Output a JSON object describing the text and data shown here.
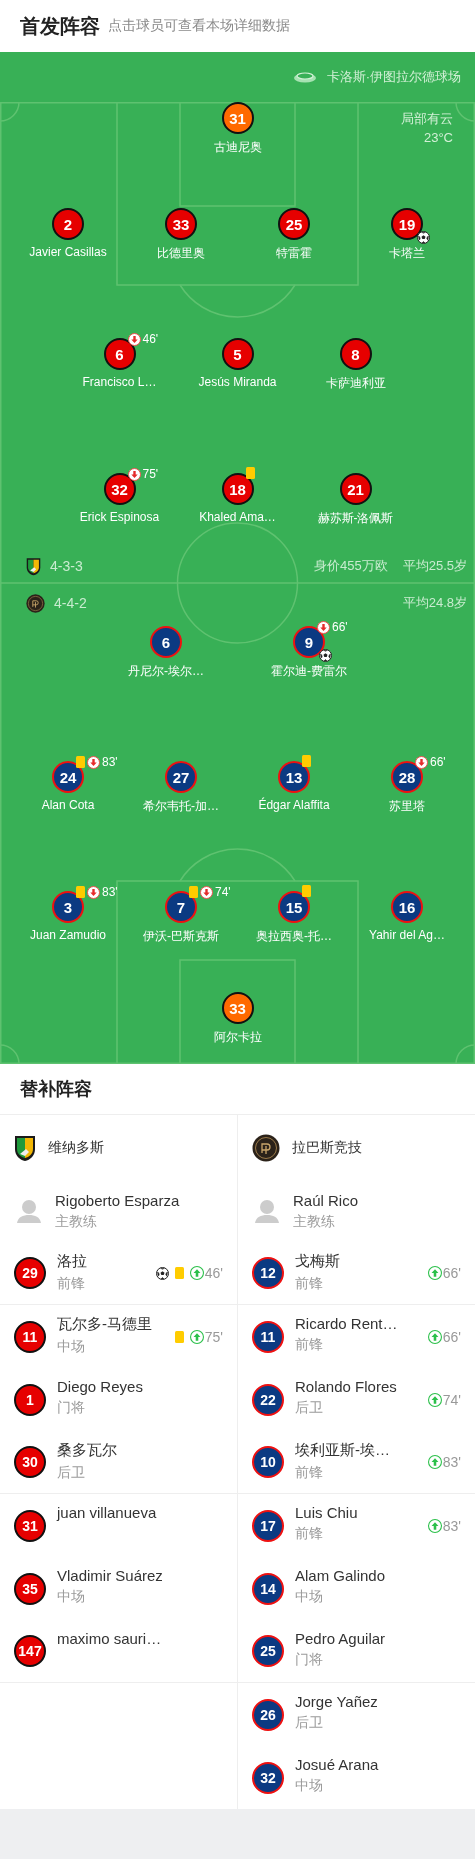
{
  "header": {
    "title": "首发阵容",
    "subtitle": "点击球员可查看本场详细数据"
  },
  "pitch": {
    "stadium": "卡洛斯·伊图拉尔德球场",
    "weather": {
      "condition": "局部有云",
      "temperature": "23°C"
    },
    "teams": [
      {
        "kind": "home",
        "formation": "4-3-3",
        "market_value": "身价455万欧",
        "average_age": "平均25.5岁",
        "lines": [
          [
            {
              "number": "31",
              "name": "古迪尼奥",
              "kind": "goalkeeper"
            }
          ],
          [
            {
              "number": "2",
              "name": "Javier Casillas",
              "kind": "outfield"
            },
            {
              "number": "33",
              "name": "比德里奥",
              "kind": "outfield"
            },
            {
              "number": "25",
              "name": "特雷霍",
              "kind": "outfield"
            },
            {
              "number": "19",
              "name": "卡塔兰",
              "kind": "outfield",
              "events": [
                {
                  "kind": "goal"
                }
              ]
            }
          ],
          [
            {
              "number": "6",
              "name": "Francisco L…",
              "kind": "outfield",
              "events": [
                {
                  "kind": "sub_out",
                  "minute": "46'"
                }
              ]
            },
            {
              "number": "5",
              "name": "Jesús Miranda",
              "kind": "outfield"
            },
            {
              "number": "8",
              "name": "卡萨迪利亚",
              "kind": "outfield"
            }
          ],
          [
            {
              "number": "32",
              "name": "Erick Espinosa",
              "kind": "outfield",
              "events": [
                {
                  "kind": "sub_out",
                  "minute": "75'"
                }
              ]
            },
            {
              "number": "18",
              "name": "Khaled Ama…",
              "kind": "outfield",
              "events": [
                {
                  "kind": "yellow_card"
                }
              ]
            },
            {
              "number": "21",
              "name": "赫苏斯-洛佩斯",
              "kind": "outfield"
            }
          ]
        ]
      },
      {
        "kind": "away",
        "formation": "4-4-2",
        "average_age": "平均24.8岁",
        "lines": [
          [
            {
              "number": "6",
              "name": "丹尼尔-埃尔…",
              "kind": "outfield"
            },
            {
              "number": "9",
              "name": "霍尔迪-费雷尔",
              "kind": "outfield",
              "events": [
                {
                  "kind": "sub_out",
                  "minute": "66'"
                },
                {
                  "kind": "goal"
                }
              ]
            }
          ],
          [
            {
              "number": "24",
              "name": "Alan Cota",
              "kind": "outfield",
              "events": [
                {
                  "kind": "yellow_card"
                },
                {
                  "kind": "sub_out",
                  "minute": "83'"
                }
              ]
            },
            {
              "number": "27",
              "name": "希尔韦托-加…",
              "kind": "outfield"
            },
            {
              "number": "13",
              "name": "Édgar Alaffita",
              "kind": "outfield",
              "events": [
                {
                  "kind": "yellow_card"
                }
              ]
            },
            {
              "number": "28",
              "name": "苏里塔",
              "kind": "outfield",
              "events": [
                {
                  "kind": "sub_out",
                  "minute": "66'"
                }
              ]
            }
          ],
          [
            {
              "number": "3",
              "name": "Juan Zamudio",
              "kind": "outfield",
              "events": [
                {
                  "kind": "yellow_card"
                },
                {
                  "kind": "sub_out",
                  "minute": "83'"
                }
              ]
            },
            {
              "number": "7",
              "name": "伊沃-巴斯克斯",
              "kind": "outfield",
              "events": [
                {
                  "kind": "yellow_card"
                },
                {
                  "kind": "sub_out",
                  "minute": "74'"
                }
              ]
            },
            {
              "number": "15",
              "name": "奥拉西奥-托…",
              "kind": "outfield",
              "events": [
                {
                  "kind": "yellow_card"
                }
              ]
            },
            {
              "number": "16",
              "name": "Yahir del Ag…",
              "kind": "outfield"
            }
          ],
          [
            {
              "number": "33",
              "name": "阿尔卡拉",
              "kind": "goalkeeper"
            }
          ]
        ]
      }
    ]
  },
  "substitutes": {
    "title": "替补阵容",
    "teams": [
      {
        "kind": "home",
        "name": "维纳多斯",
        "coach": {
          "name": "Rigoberto Esparza",
          "role": "主教练"
        },
        "players": [
          {
            "number": "29",
            "name": "洛拉",
            "position": "前锋",
            "events": [
              {
                "kind": "goal"
              },
              {
                "kind": "yellow_card"
              },
              {
                "kind": "sub_in",
                "minute": "46'"
              }
            ]
          },
          {
            "number": "11",
            "name": "瓦尔多-马德里",
            "position": "中场",
            "events": [
              {
                "kind": "yellow_card"
              },
              {
                "kind": "sub_in",
                "minute": "75'"
              }
            ]
          },
          {
            "number": "1",
            "name": "Diego Reyes",
            "position": "门将"
          },
          {
            "number": "30",
            "name": "桑多瓦尔",
            "position": "后卫"
          },
          {
            "number": "31",
            "name": "juan villanueva"
          },
          {
            "number": "35",
            "name": "Vladimir Suárez",
            "position": "中场"
          },
          {
            "number": "147",
            "name": "maximo sauri…"
          }
        ]
      },
      {
        "kind": "away",
        "name": "拉巴斯竞技",
        "coach": {
          "name": "Raúl Rico",
          "role": "主教练"
        },
        "players": [
          {
            "number": "12",
            "name": "戈梅斯",
            "position": "前锋",
            "events": [
              {
                "kind": "sub_in",
                "minute": "66'"
              }
            ]
          },
          {
            "number": "11",
            "name": "Ricardo Rent…",
            "position": "前锋",
            "events": [
              {
                "kind": "sub_in",
                "minute": "66'"
              }
            ]
          },
          {
            "number": "22",
            "name": "Rolando Flores",
            "position": "后卫",
            "events": [
              {
                "kind": "sub_in",
                "minute": "74'"
              }
            ]
          },
          {
            "number": "10",
            "name": "埃利亚斯-埃…",
            "position": "前锋",
            "events": [
              {
                "kind": "sub_in",
                "minute": "83'"
              }
            ]
          },
          {
            "number": "17",
            "name": "Luis Chiu",
            "position": "前锋",
            "events": [
              {
                "kind": "sub_in",
                "minute": "83'"
              }
            ]
          },
          {
            "number": "14",
            "name": "Alam Galindo",
            "position": "中场"
          },
          {
            "number": "25",
            "name": "Pedro Aguilar",
            "position": "门将"
          },
          {
            "number": "26",
            "name": "Jorge Yañez",
            "position": "后卫"
          },
          {
            "number": "32",
            "name": "Josué Arana",
            "position": "中场"
          }
        ]
      }
    ]
  }
}
